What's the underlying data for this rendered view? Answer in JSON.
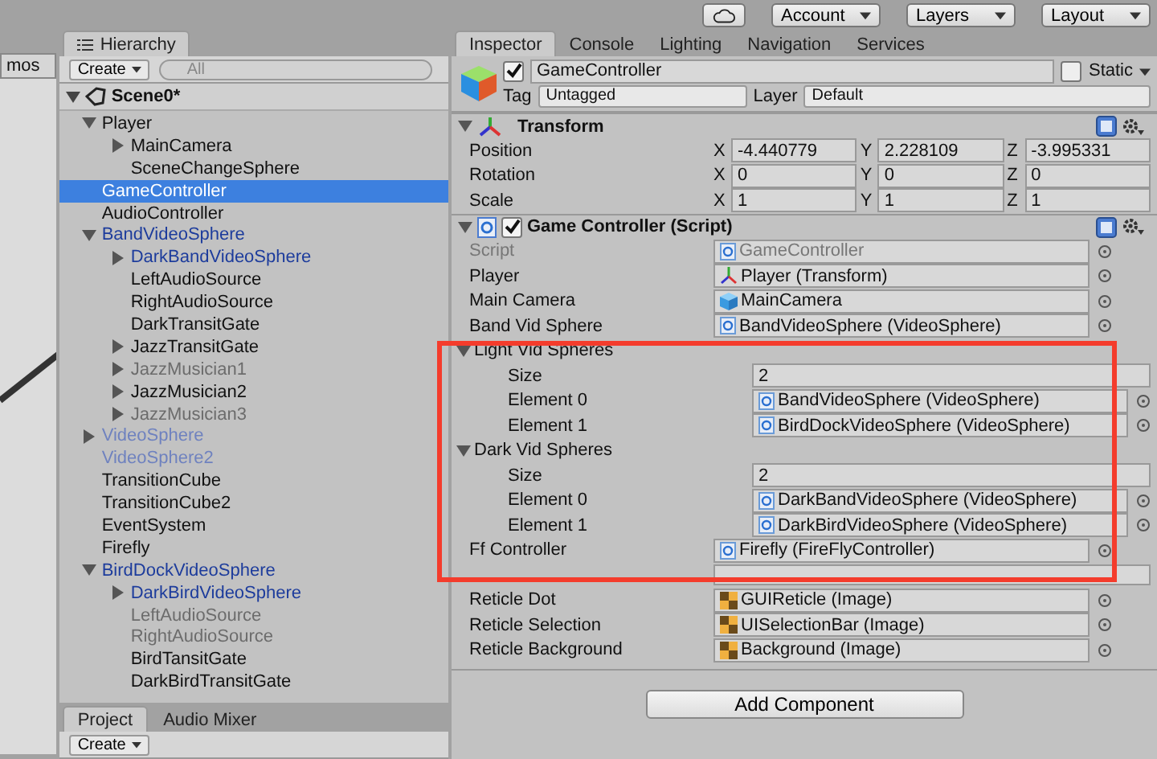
{
  "toolbar": {
    "buttons": [
      {
        "label": "Account"
      },
      {
        "label": "Layers"
      },
      {
        "label": "Layout"
      }
    ]
  },
  "scene_view": {
    "toolbar_label": "mos"
  },
  "hierarchy": {
    "tab": "Hierarchy",
    "create": "Create",
    "search_placeholder": "All",
    "scene": {
      "name": "Scene0*",
      "expanded": true
    },
    "items": [
      {
        "name": "Player",
        "prefab": false,
        "active": true,
        "selected": false,
        "expanded": true,
        "children": [
          {
            "name": "MainCamera",
            "prefab": false,
            "active": true,
            "selected": false,
            "expanded": false
          },
          {
            "name": "SceneChangeSphere",
            "prefab": false,
            "active": true,
            "selected": false
          }
        ]
      },
      {
        "name": "GameController",
        "prefab": false,
        "active": true,
        "selected": true
      },
      {
        "name": "AudioController",
        "prefab": false,
        "active": true,
        "selected": false
      },
      {
        "name": "BandVideoSphere",
        "prefab": true,
        "active": true,
        "selected": false,
        "expanded": true,
        "children": [
          {
            "name": "DarkBandVideoSphere",
            "prefab": true,
            "active": true,
            "selected": false,
            "expanded": false
          },
          {
            "name": "LeftAudioSource",
            "prefab": false,
            "active": true,
            "selected": false
          },
          {
            "name": "RightAudioSource",
            "prefab": false,
            "active": true,
            "selected": false
          },
          {
            "name": "DarkTransitGate",
            "prefab": false,
            "active": true,
            "selected": false
          },
          {
            "name": "JazzTransitGate",
            "prefab": false,
            "active": true,
            "selected": false,
            "expanded": false
          },
          {
            "name": "JazzMusician1",
            "prefab": false,
            "active": false,
            "selected": false,
            "expanded": false
          },
          {
            "name": "JazzMusician2",
            "prefab": false,
            "active": true,
            "selected": false,
            "expanded": false
          },
          {
            "name": "JazzMusician3",
            "prefab": false,
            "active": false,
            "selected": false,
            "expanded": false
          }
        ]
      },
      {
        "name": "VideoSphere",
        "prefab": true,
        "active": false,
        "selected": false,
        "expanded": false
      },
      {
        "name": "VideoSphere2",
        "prefab": true,
        "active": false,
        "selected": false
      },
      {
        "name": "TransitionCube",
        "prefab": false,
        "active": true,
        "selected": false
      },
      {
        "name": "TransitionCube2",
        "prefab": false,
        "active": true,
        "selected": false
      },
      {
        "name": "EventSystem",
        "prefab": false,
        "active": true,
        "selected": false
      },
      {
        "name": "Firefly",
        "prefab": false,
        "active": true,
        "selected": false
      },
      {
        "name": "BirdDockVideoSphere",
        "prefab": true,
        "active": true,
        "selected": false,
        "expanded": true,
        "children": [
          {
            "name": "DarkBirdVideoSphere",
            "prefab": true,
            "active": true,
            "selected": false,
            "expanded": false
          },
          {
            "name": "LeftAudioSource",
            "prefab": false,
            "active": false,
            "selected": false
          },
          {
            "name": "RightAudioSource",
            "prefab": false,
            "active": false,
            "selected": false
          },
          {
            "name": "BirdTansitGate",
            "prefab": false,
            "active": true,
            "selected": false
          },
          {
            "name": "DarkBirdTransitGate",
            "prefab": false,
            "active": true,
            "selected": false
          }
        ]
      }
    ]
  },
  "bottom_tabs": [
    {
      "label": "Project",
      "selected": true
    },
    {
      "label": "Audio Mixer",
      "selected": false
    }
  ],
  "bottom_create": "Create",
  "inspector": {
    "tabs": [
      {
        "label": "Inspector",
        "selected": true
      },
      {
        "label": "Console",
        "selected": false
      },
      {
        "label": "Lighting",
        "selected": false
      },
      {
        "label": "Navigation",
        "selected": false
      },
      {
        "label": "Services",
        "selected": false
      }
    ],
    "object": {
      "active": true,
      "name": "GameController",
      "static_label": "Static",
      "static": false,
      "tag_label": "Tag",
      "tag": "Untagged",
      "layer_label": "Layer",
      "layer": "Default"
    },
    "transform": {
      "title": "Transform",
      "expanded": true,
      "rows": [
        {
          "label": "Position",
          "fields": [
            {
              "axis": "X",
              "value": "-4.440779"
            },
            {
              "axis": "Y",
              "value": "2.228109"
            },
            {
              "axis": "Z",
              "value": "-3.995331"
            }
          ]
        },
        {
          "label": "Rotation",
          "fields": [
            {
              "axis": "X",
              "value": "0"
            },
            {
              "axis": "Y",
              "value": "0"
            },
            {
              "axis": "Z",
              "value": "0"
            }
          ]
        },
        {
          "label": "Scale",
          "fields": [
            {
              "axis": "X",
              "value": "1"
            },
            {
              "axis": "Y",
              "value": "1"
            },
            {
              "axis": "Z",
              "value": "1"
            }
          ]
        }
      ]
    },
    "script_component": {
      "title": "Game Controller (Script)",
      "enabled": true,
      "expanded": true,
      "properties": [
        {
          "kind": "script_ref",
          "label": "Script",
          "value": "GameController",
          "disabled": true
        },
        {
          "kind": "transform_ref",
          "label": "Player",
          "value": "Player (Transform)",
          "disabled": false
        },
        {
          "kind": "gameobject_ref",
          "label": "Main Camera",
          "value": "MainCamera",
          "disabled": false
        },
        {
          "kind": "script_ref",
          "label": "Band Vid Sphere",
          "value": "BandVideoSphere (VideoSphere)",
          "disabled": false
        },
        {
          "kind": "array",
          "label": "Light Vid Spheres",
          "expanded": true,
          "children": [
            {
              "kind": "number",
              "label": "Size",
              "value": "2"
            },
            {
              "kind": "script_ref",
              "label": "Element 0",
              "value": "BandVideoSphere (VideoSphere)",
              "disabled": false
            },
            {
              "kind": "script_ref",
              "label": "Element 1",
              "value": "BirdDockVideoSphere (VideoSphere)",
              "disabled": false
            }
          ]
        },
        {
          "kind": "array",
          "label": "Dark Vid Spheres",
          "expanded": true,
          "children": [
            {
              "kind": "number",
              "label": "Size",
              "value": "2"
            },
            {
              "kind": "script_ref",
              "label": "Element 0",
              "value": "DarkBandVideoSphere (VideoSphere)",
              "disabled": false
            },
            {
              "kind": "script_ref",
              "label": "Element 1",
              "value": "DarkBirdVideoSphere (VideoSphere)",
              "disabled": false
            }
          ]
        },
        {
          "kind": "script_ref",
          "label": "Ff Controller",
          "value": "Firefly (FireFlyController)",
          "disabled": false
        },
        {
          "kind": "covered"
        },
        {
          "kind": "image_ref",
          "label": "Reticle Dot",
          "value": "GUIReticle (Image)",
          "disabled": false
        },
        {
          "kind": "image_ref",
          "label": "Reticle Selection",
          "value": "UISelectionBar (Image)",
          "disabled": false
        },
        {
          "kind": "image_ref",
          "label": "Reticle Background",
          "value": "Background (Image)",
          "disabled": false
        }
      ]
    },
    "add_component": "Add Component"
  }
}
